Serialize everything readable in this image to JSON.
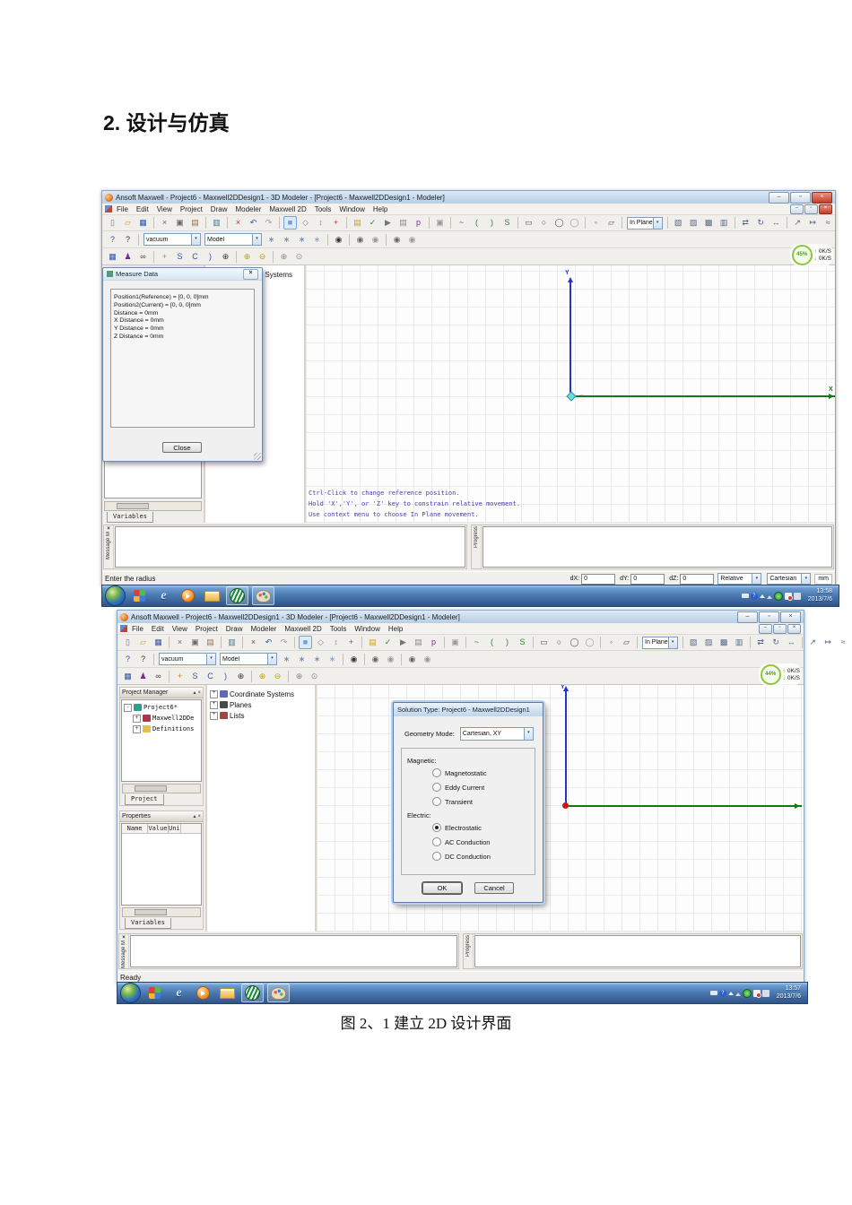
{
  "page": {
    "heading": "2. 设计与仿真",
    "caption": "图 2、1  建立 2D 设计界面"
  },
  "app": {
    "title": "Ansoft Maxwell - Project6 - Maxwell2DDesign1 - 3D Modeler - [Project6 - Maxwell2DDesign1 - Modeler]",
    "menus": [
      {
        "label": "File"
      },
      {
        "label": "Edit"
      },
      {
        "label": "View"
      },
      {
        "label": "Project"
      },
      {
        "label": "Draw"
      },
      {
        "label": "Modeler"
      },
      {
        "label": "Maxwell 2D"
      },
      {
        "label": "Tools"
      },
      {
        "label": "Window"
      },
      {
        "label": "Help"
      }
    ],
    "dropdowns": {
      "material": "vacuum",
      "model": "Model",
      "plane": "In Plane"
    },
    "axis_y": "Y",
    "axis_x": "X",
    "net_up": "0K/S",
    "net_down": "0K/S",
    "toolbar1a": [
      {
        "name": "new-icon",
        "g": "▯",
        "c": "#7a7a7a"
      },
      {
        "name": "open-icon",
        "g": "▱",
        "c": "#c79b2e"
      },
      {
        "name": "save-icon",
        "g": "▦",
        "c": "#2f55b0"
      },
      {
        "sep": 1
      },
      {
        "name": "cut-icon",
        "g": "×",
        "c": "#6a6a6a"
      },
      {
        "name": "copy-icon",
        "g": "▣",
        "c": "#6a6a6a"
      },
      {
        "name": "paste-icon",
        "g": "▤",
        "c": "#9a7342"
      },
      {
        "sep": 1
      },
      {
        "name": "print-icon",
        "g": "▥",
        "c": "#3d7a8a"
      },
      {
        "sep": 1
      },
      {
        "name": "delete-icon",
        "g": "×",
        "c": "#b03a2e"
      },
      {
        "name": "undo-icon",
        "g": "↶",
        "c": "#2f55b0"
      },
      {
        "name": "redo-icon",
        "g": "↷",
        "c": "#9a9a9a"
      },
      {
        "sep": 1
      },
      {
        "name": "orientation-icon",
        "g": "■",
        "c": "#6f9fd4",
        "cls": "pressed"
      },
      {
        "name": "snap-icon",
        "g": "◇",
        "c": "#888888"
      },
      {
        "name": "measure-mode-icon",
        "g": "↕",
        "c": "#888888"
      },
      {
        "name": "coordinate-system-icon",
        "g": "+",
        "c": "#b03a2e"
      },
      {
        "sep": 1
      },
      {
        "name": "material-db-icon",
        "g": "▤",
        "c": "#c9a21d"
      },
      {
        "name": "validate-icon",
        "g": "✓",
        "c": "#2e8b2e"
      },
      {
        "name": "analyze-icon",
        "g": "▶",
        "c": "#777777"
      },
      {
        "name": "results-icon",
        "g": "▤",
        "c": "#888888"
      },
      {
        "name": "optimetrics-icon",
        "g": "p",
        "c": "#7a2a8a"
      },
      {
        "sep": 1
      },
      {
        "name": "copy-screen-icon",
        "g": "▣",
        "c": "#999999"
      },
      {
        "sep": 1
      },
      {
        "name": "draw-line-icon",
        "g": "~",
        "c": "#2e7d32"
      },
      {
        "name": "draw-arc-icon",
        "g": "(",
        "c": "#2e7d32"
      },
      {
        "name": "draw-arc3-icon",
        "g": ")",
        "c": "#2e7d32"
      },
      {
        "name": "draw-spline-icon",
        "g": "S",
        "c": "#2e7d32"
      },
      {
        "sep": 1
      },
      {
        "name": "draw-rect-icon",
        "g": "▭",
        "c": "#555555"
      },
      {
        "name": "draw-circle-icon",
        "g": "○",
        "c": "#555555"
      },
      {
        "name": "draw-ellipse-icon",
        "g": "◯",
        "c": "#555555"
      },
      {
        "name": "draw-oval-icon",
        "g": "◯",
        "c": "#999999"
      },
      {
        "sep": 1
      },
      {
        "name": "draw-point-icon",
        "g": "◦",
        "c": "#555555"
      },
      {
        "name": "draw-plane-icon",
        "g": "▱",
        "c": "#555555"
      },
      {
        "sep": 1
      }
    ],
    "toolbar1b": [
      {
        "sep": 1
      },
      {
        "name": "unite-icon",
        "g": "▧",
        "c": "#556688"
      },
      {
        "name": "subtract-icon",
        "g": "▨",
        "c": "#556688"
      },
      {
        "name": "intersect-icon",
        "g": "▩",
        "c": "#556688"
      },
      {
        "name": "split-icon",
        "g": "▥",
        "c": "#556688"
      },
      {
        "sep": 1
      },
      {
        "name": "duplicate-line-icon",
        "g": "⇄",
        "c": "#556688"
      },
      {
        "name": "duplicate-rotate-icon",
        "g": "↻",
        "c": "#556688"
      },
      {
        "name": "mirror-icon",
        "g": "↔",
        "c": "#556688"
      },
      {
        "sep": 1
      },
      {
        "name": "scale-icon",
        "g": "↗",
        "c": "#556688"
      },
      {
        "name": "offset-icon",
        "g": "↦",
        "c": "#556688"
      },
      {
        "name": "sweep-icon",
        "g": "≈",
        "c": "#556688"
      }
    ],
    "toolbar2a": [
      {
        "name": "help-pointer-icon",
        "g": "?",
        "c": "#2f55b0"
      },
      {
        "name": "whats-this-icon",
        "g": "?",
        "c": "#333333"
      },
      {
        "sep": 1
      }
    ],
    "toolbar2b": [
      {
        "name": "align-x-icon",
        "g": "∗",
        "c": "#6a86ad"
      },
      {
        "name": "align-y-icon",
        "g": "∗",
        "c": "#6a86ad"
      },
      {
        "name": "align-z-icon",
        "g": "∗",
        "c": "#6a86ad"
      },
      {
        "name": "align-plane-icon",
        "g": "∗",
        "c": "#8aa0c0"
      },
      {
        "sep": 1
      },
      {
        "name": "visibility-icon",
        "g": "◉",
        "c": "#333333"
      },
      {
        "sep": 1
      },
      {
        "name": "show-selection-icon",
        "g": "◉",
        "c": "#666666"
      },
      {
        "name": "hide-selection-icon",
        "g": "◉",
        "c": "#999999"
      },
      {
        "sep": 1
      },
      {
        "name": "show-all-icon",
        "g": "◉",
        "c": "#666666"
      },
      {
        "name": "hide-all-icon",
        "g": "◉",
        "c": "#999999"
      }
    ],
    "toolbar3": [
      {
        "name": "grid-settings-icon",
        "g": "▦",
        "c": "#2f55b0"
      },
      {
        "name": "boundary-display-icon",
        "g": "♟",
        "c": "#7a2a8a"
      },
      {
        "name": "find-icon",
        "g": "∞",
        "c": "#444444"
      },
      {
        "sep": 1
      },
      {
        "name": "pan-icon",
        "g": "+",
        "c": "#c08a2a"
      },
      {
        "name": "rotate-center-icon",
        "g": "S",
        "c": "#2f55b0"
      },
      {
        "name": "rotate-view-icon",
        "g": "C",
        "c": "#2f55b0"
      },
      {
        "name": "rotate-axis-icon",
        "g": ")",
        "c": "#2f55b0"
      },
      {
        "name": "zoom-cursor-icon",
        "g": "⊕",
        "c": "#333333"
      },
      {
        "sep": 1
      },
      {
        "name": "zoom-in-icon",
        "g": "⊕",
        "c": "#b8a11a"
      },
      {
        "name": "zoom-out-icon",
        "g": "⊖",
        "c": "#b8a11a"
      },
      {
        "sep": 1
      },
      {
        "name": "zoom-window-icon",
        "g": "⊕",
        "c": "#888888"
      },
      {
        "name": "zoom-fit-icon",
        "g": "⊙",
        "c": "#888888"
      }
    ],
    "history_tree": [
      {
        "name": "tree-item-coordinate-systems",
        "pm": "+",
        "ic": "#5a6abf",
        "label": "Coordinate Systems"
      },
      {
        "name": "tree-item-planes",
        "pm": "+",
        "ic": "#4a4a4a",
        "label": "Planes"
      },
      {
        "name": "tree-item-lists",
        "pm": "+",
        "ic": "#a2453a",
        "label": "Lists"
      }
    ],
    "taskbar": [
      {
        "name": "start-button",
        "cls": "orb"
      },
      {
        "name": "app-colors-icon",
        "cls": "grid4"
      },
      {
        "name": "ie-icon",
        "cls": "ie"
      },
      {
        "name": "media-player-icon",
        "cls": "wmp"
      },
      {
        "name": "explorer-icon",
        "cls": "folder"
      },
      {
        "name": "maxwell-taskbar-icon",
        "cls": "maxwell on"
      },
      {
        "name": "paint-taskbar-icon",
        "cls": "paint on"
      }
    ],
    "tray": [
      {
        "name": "keyboard-tray-icon",
        "cls": "tr-kb"
      },
      {
        "name": "help-tray-icon",
        "cls": "tr-q"
      },
      {
        "name": "hidden-icons-arrow",
        "cls": "tr-up"
      },
      {
        "name": "uac-tray-icon",
        "cls": "tr-tri"
      },
      {
        "name": "antivirus-tray-icon",
        "cls": "tr-av"
      },
      {
        "name": "action-center-flag-icon",
        "cls": "tr-flag"
      },
      {
        "name": "network-tray-icon",
        "cls": "tr-net"
      }
    ]
  },
  "docks": {
    "message": "Message M",
    "progress": "Progress"
  },
  "shot1": {
    "net_percent": "45%",
    "variables_tab": "Variables",
    "measure_dialog": {
      "title": "Measure Data",
      "lines": [
        {
          "t": "Position1(Reference) = [0, 0, 0]mm"
        },
        {
          "t": "Position2(Current) = [0, 0, 0]mm"
        },
        {
          "t": "Distance = 0mm"
        },
        {
          "t": "X Distance = 0mm"
        },
        {
          "t": "Y Distance = 0mm"
        },
        {
          "t": "Z Distance = 0mm"
        }
      ],
      "close_label": "Close"
    },
    "hints": [
      {
        "t": "Ctrl-Click to change reference position."
      },
      {
        "t": "Hold 'X','Y', or 'Z' key to constrain relative movement."
      },
      {
        "t": "Use context menu to choose In Plane movement."
      }
    ],
    "status": {
      "left": "Enter the radius",
      "fields": [
        {
          "label": "dX:",
          "value": "0"
        },
        {
          "label": "dY:",
          "value": "0"
        },
        {
          "label": "dZ:",
          "value": "0"
        }
      ],
      "mode1": "Relative",
      "mode2": "Cartesian",
      "unit": "mm"
    },
    "tray": {
      "time": "13:58",
      "date": "2013/7/6"
    }
  },
  "shot2": {
    "net_percent": "44%",
    "project_manager": {
      "title": "Project Manager",
      "tree": [
        {
          "name": "tree-item-project6",
          "pm": "-",
          "ic": "#2e9e8e",
          "label": "Project6*"
        },
        {
          "name": "tree-item-maxwell2ddesign",
          "pm": "+",
          "ic": "#b23545",
          "label": "Maxwell2DDe",
          "ind": 1
        },
        {
          "name": "tree-item-definitions",
          "pm": "+",
          "ic": "#e3bf4f",
          "label": "Definitions",
          "ind": 1
        }
      ],
      "tab": "Project"
    },
    "properties": {
      "title": "Properties",
      "cols": [
        {
          "label": "Name"
        },
        {
          "label": "Value"
        },
        {
          "label": "Uni"
        }
      ],
      "tab": "Variables"
    },
    "solution_dialog": {
      "title": "Solution Type: Project6 - Maxwell2DDesign1",
      "geometry_label": "Geometry Mode:",
      "geometry_value": "Cartesian, XY",
      "magnetic_label": "Magnetic:",
      "magnetic": [
        {
          "label": "Magnetostatic"
        },
        {
          "label": "Eddy Current"
        },
        {
          "label": "Transient"
        }
      ],
      "electric_label": "Electric:",
      "electric": [
        {
          "label": "Electrostatic",
          "sel": 1
        },
        {
          "label": "AC Conduction"
        },
        {
          "label": "DC Conduction"
        }
      ],
      "ok": "OK",
      "cancel": "Cancel"
    },
    "status": {
      "left": "Ready"
    },
    "tray": {
      "time": "13:57",
      "date": "2013/7/6"
    }
  }
}
